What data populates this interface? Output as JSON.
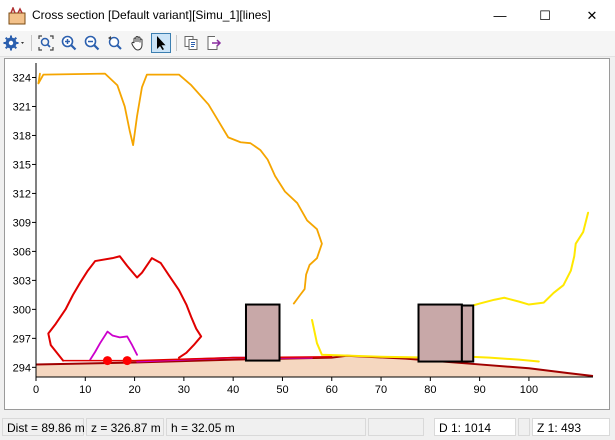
{
  "window": {
    "title": "Cross section [Default variant][Simu_1][lines]",
    "minimize_glyph": "—",
    "maximize_glyph": "☐",
    "close_glyph": "✕"
  },
  "toolbar": {
    "tools": [
      {
        "name": "settings-icon",
        "active": false
      },
      {
        "name": "zoom-extent-icon",
        "active": false
      },
      {
        "name": "zoom-in-icon",
        "active": false
      },
      {
        "name": "zoom-out-icon",
        "active": false
      },
      {
        "name": "zoom-previous-icon",
        "active": false
      },
      {
        "name": "pan-hand-icon",
        "active": false
      },
      {
        "name": "select-pointer-icon",
        "active": true
      },
      {
        "name": "copy-icon",
        "active": false
      },
      {
        "name": "export-icon",
        "active": false
      }
    ]
  },
  "status": {
    "dist": "Dist = 89.86 m",
    "z": "z = 326.87 m",
    "h": "h = 32.05 m",
    "d_scale": "D  1: 1014",
    "z_scale": "Z  1: 493"
  },
  "chart_data": {
    "type": "line",
    "x_ticks": [
      0,
      10,
      20,
      30,
      40,
      50,
      60,
      70,
      80,
      90,
      100
    ],
    "y_ticks": [
      294,
      297,
      300,
      303,
      306,
      309,
      312,
      315,
      318,
      321,
      324
    ],
    "xlim": [
      0,
      113
    ],
    "ylim": [
      293,
      325.5
    ],
    "ground": {
      "fill": "#f5d7c0",
      "line_color": "#a00000",
      "points": [
        [
          0,
          294.3
        ],
        [
          20,
          294.5
        ],
        [
          40,
          294.8
        ],
        [
          60,
          295.0
        ],
        [
          63,
          295.2
        ],
        [
          75,
          294.9
        ],
        [
          90,
          294.3
        ],
        [
          100,
          293.9
        ],
        [
          108,
          293.4
        ],
        [
          113,
          293.1
        ]
      ]
    },
    "buildings": [
      {
        "x0": 42.6,
        "x1": 49.4,
        "bottom": 294.7,
        "top": 300.5,
        "fill": "#c8a8a8"
      },
      {
        "x0": 77.6,
        "x1": 86.4,
        "bottom": 294.6,
        "top": 300.5,
        "fill": "#c8a8a8"
      },
      {
        "x0": 86.4,
        "x1": 88.7,
        "bottom": 294.6,
        "top": 300.4,
        "fill": "#c8a8a8"
      }
    ],
    "series": [
      {
        "color": "#f5a500",
        "width": 1.8,
        "points": [
          [
            0.5,
            323.4
          ],
          [
            1.5,
            324.3
          ],
          [
            14,
            324.4
          ],
          [
            16.5,
            323.2
          ],
          [
            18,
            321
          ],
          [
            19,
            318.5
          ],
          [
            19.7,
            317
          ],
          [
            20.5,
            320
          ],
          [
            21.5,
            323
          ],
          [
            22.5,
            324.3
          ],
          [
            29,
            324.3
          ],
          [
            31.5,
            323.2
          ],
          [
            35,
            321.2
          ],
          [
            37,
            319.5
          ],
          [
            39,
            317.8
          ],
          [
            41.5,
            317.3
          ],
          [
            43.5,
            317.2
          ],
          [
            45.5,
            316.5
          ],
          [
            47,
            315.5
          ],
          [
            48.5,
            313.8
          ],
          [
            50.5,
            312.2
          ],
          [
            53,
            311
          ],
          [
            55,
            309.2
          ],
          [
            57,
            308.3
          ],
          [
            58,
            306.8
          ],
          [
            57,
            305.3
          ],
          [
            55.5,
            304.6
          ],
          [
            54.8,
            303.6
          ],
          [
            54.5,
            302.1
          ],
          [
            53.6,
            301.5
          ],
          [
            52.3,
            300.6
          ]
        ]
      },
      {
        "color": "#f5a500",
        "width": 1.8,
        "points": [
          [
            0.5,
            323.4
          ],
          [
            0.8,
            324.4
          ]
        ]
      },
      {
        "color": "#e00000",
        "width": 2,
        "points": [
          [
            5.5,
            294.7
          ],
          [
            3,
            296.3
          ],
          [
            2.5,
            297.5
          ],
          [
            4,
            298.5
          ],
          [
            6,
            300
          ],
          [
            7.5,
            301.5
          ],
          [
            9,
            302.8
          ],
          [
            10.5,
            304
          ],
          [
            12,
            305
          ],
          [
            15.5,
            305.3
          ],
          [
            17,
            305.5
          ],
          [
            18.5,
            304.5
          ],
          [
            20.5,
            303.3
          ],
          [
            21.5,
            303.8
          ],
          [
            23.5,
            305.3
          ],
          [
            25.3,
            304.8
          ],
          [
            27,
            303.5
          ],
          [
            29,
            302
          ],
          [
            30.5,
            300.5
          ],
          [
            31.5,
            299.2
          ],
          [
            32.5,
            298
          ],
          [
            33.5,
            297.2
          ],
          [
            32,
            296.3
          ],
          [
            30.5,
            295.5
          ],
          [
            29,
            295
          ]
        ]
      },
      {
        "color": "#cc00cc",
        "width": 1.8,
        "points": [
          [
            11,
            294.8
          ],
          [
            12,
            295.6
          ],
          [
            13,
            296.5
          ],
          [
            14.5,
            297.7
          ],
          [
            15.5,
            297.3
          ],
          [
            17,
            297.1
          ],
          [
            18.5,
            297.2
          ],
          [
            19.5,
            296.3
          ],
          [
            20.5,
            295.3
          ]
        ]
      },
      {
        "color": "#ffe800",
        "width": 2,
        "points": [
          [
            56,
            298.9
          ],
          [
            57,
            296.5
          ],
          [
            58,
            295.3
          ],
          [
            70,
            295.1
          ],
          [
            80,
            295.0
          ],
          [
            88,
            295.1
          ],
          [
            92,
            295.0
          ],
          [
            98,
            294.8
          ],
          [
            102,
            294.6
          ]
        ]
      },
      {
        "color": "#ffe800",
        "width": 2,
        "points": [
          [
            88.6,
            300.4
          ],
          [
            90,
            300.6
          ],
          [
            93,
            301
          ],
          [
            95,
            301.2
          ],
          [
            98,
            300.8
          ],
          [
            100,
            300.5
          ],
          [
            103,
            300.7
          ],
          [
            105,
            301.7
          ],
          [
            107,
            302.5
          ],
          [
            108.5,
            304
          ],
          [
            109.2,
            305.5
          ],
          [
            109.5,
            306.8
          ],
          [
            111,
            308
          ],
          [
            112,
            310
          ]
        ]
      },
      {
        "color": "#cc00cc",
        "width": 1.8,
        "points": [
          [
            20.5,
            294.6
          ],
          [
            40,
            295.0
          ],
          [
            56,
            295.0
          ]
        ]
      },
      {
        "color": "#e00000",
        "width": 1.5,
        "points": [
          [
            5.5,
            294.7
          ],
          [
            20,
            294.7
          ],
          [
            40,
            295.0
          ],
          [
            60,
            295.1
          ]
        ]
      }
    ],
    "markers": [
      {
        "x": 14.5,
        "y": 294.7,
        "color": "#ff0000"
      },
      {
        "x": 18.5,
        "y": 294.7,
        "color": "#ff0000"
      }
    ]
  }
}
